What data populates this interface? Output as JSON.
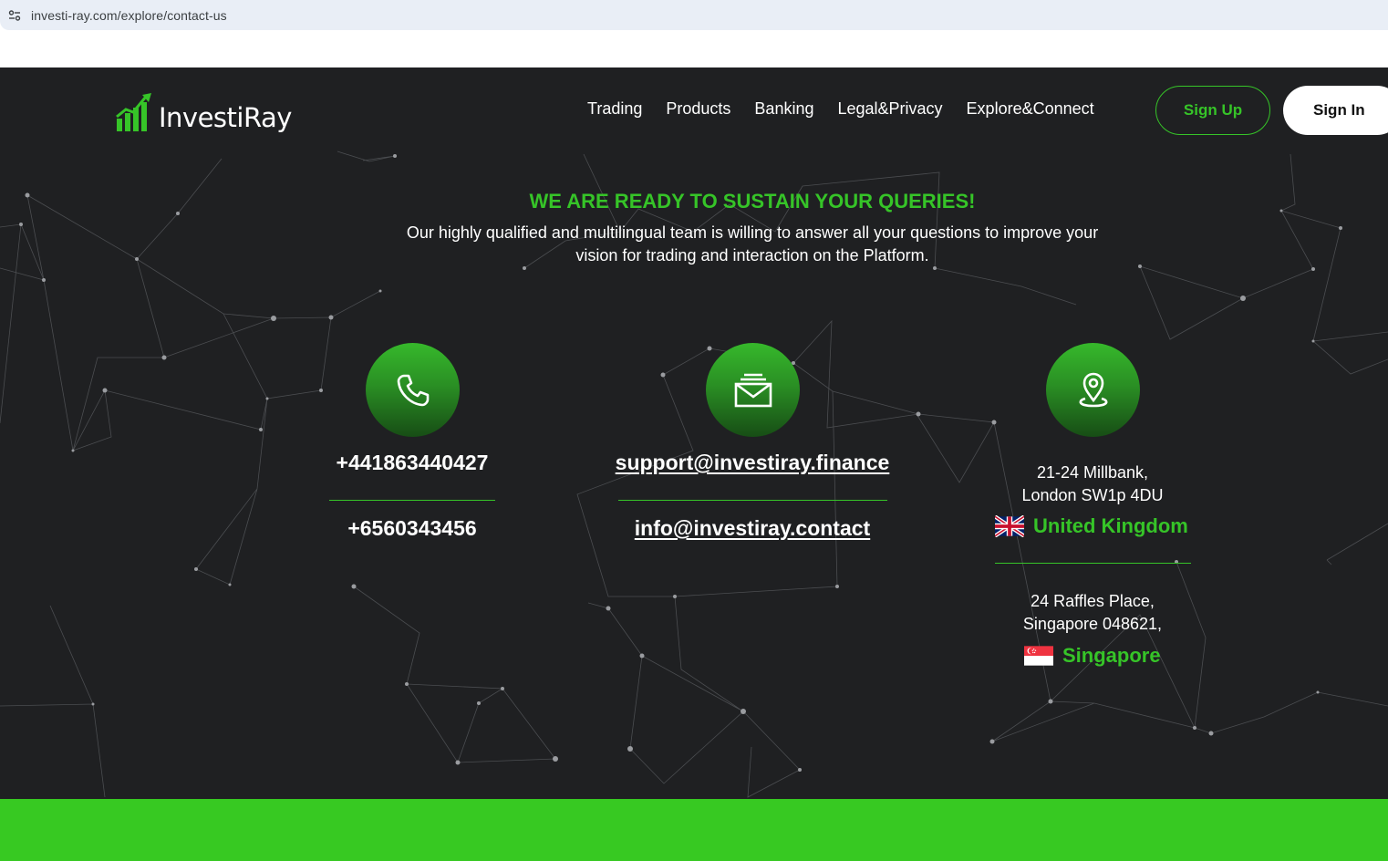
{
  "browser": {
    "url": "investi-ray.com/explore/contact-us",
    "site_info_icon": "tune-icon"
  },
  "header": {
    "logo_text": "InvestiRay",
    "nav": [
      "Trading",
      "Products",
      "Banking",
      "Legal&Privacy",
      "Explore&Connect"
    ],
    "signup_label": "Sign Up",
    "signin_label": "Sign In"
  },
  "hero": {
    "title": "WE ARE READY TO SUSTAIN YOUR QUERIES!",
    "subtitle": "Our highly qualified and multilingual team is willing to answer all your questions to improve your vision for trading and interaction on the Platform."
  },
  "contacts": {
    "phone": {
      "icon": "phone-icon",
      "numbers": [
        "+441863440427",
        "+6560343456"
      ]
    },
    "email": {
      "icon": "mail-icon",
      "addresses": [
        "support@investiray.finance",
        "info@investiray.contact"
      ]
    },
    "location": {
      "icon": "location-pin-icon",
      "offices": [
        {
          "line1": "21-24 Millbank,",
          "line2": "London SW1p 4DU",
          "country": "United Kingdom",
          "flag": "uk-flag-icon"
        },
        {
          "line1": "24 Raffles Place,",
          "line2": "Singapore 048621,",
          "country": "Singapore",
          "flag": "singapore-flag-icon"
        }
      ]
    }
  },
  "colors": {
    "accent": "#36c428",
    "background": "#1f2022",
    "footer_bar": "#37c922"
  }
}
